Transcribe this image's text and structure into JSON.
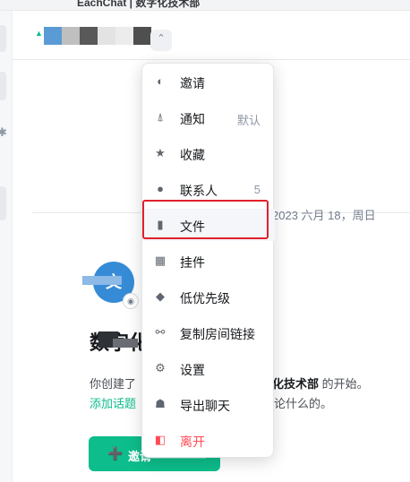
{
  "window": {
    "title": "EachChat | 数字化技术部"
  },
  "room_header": {
    "mosaic_colors": [
      "#5b9bd5",
      "#9bc3e8",
      "#bfbfbf",
      "#595959",
      "#ffffff",
      "#e3e3e3",
      "#cccccc",
      "#4f4f4f"
    ]
  },
  "timeline": {
    "date_separator": "2023 六月 18，周日"
  },
  "room_intro": {
    "avatar_letter": "文",
    "room_name": "数字化技术部",
    "text1_start": "你创建了",
    "text1_room": "化技术部",
    "text1_end": " 的开始。",
    "add_topic_link": "添加话题",
    "text2_end": "论什么的。",
    "invite_button": "邀请"
  },
  "context_menu": {
    "items": [
      {
        "label": "邀请",
        "icon": "invite-icon",
        "extra": ""
      },
      {
        "label": "通知",
        "icon": "bell-icon",
        "extra": "默认"
      },
      {
        "label": "收藏",
        "icon": "star-icon",
        "extra": ""
      },
      {
        "label": "联系人",
        "icon": "people-icon",
        "extra": "5"
      },
      {
        "label": "文件",
        "icon": "file-icon",
        "extra": ""
      },
      {
        "label": "挂件",
        "icon": "widgets-icon",
        "extra": ""
      },
      {
        "label": "低优先级",
        "icon": "low-priority-icon",
        "extra": ""
      },
      {
        "label": "复制房间链接",
        "icon": "link-icon",
        "extra": ""
      },
      {
        "label": "设置",
        "icon": "gear-icon",
        "extra": ""
      },
      {
        "label": "导出聊天",
        "icon": "export-icon",
        "extra": ""
      },
      {
        "label": "离开",
        "icon": "leave-icon",
        "extra": ""
      }
    ]
  },
  "colors": {
    "accent": "#0dbd8b",
    "danger": "#ff4b55",
    "highlight_border": "#e0202c"
  }
}
